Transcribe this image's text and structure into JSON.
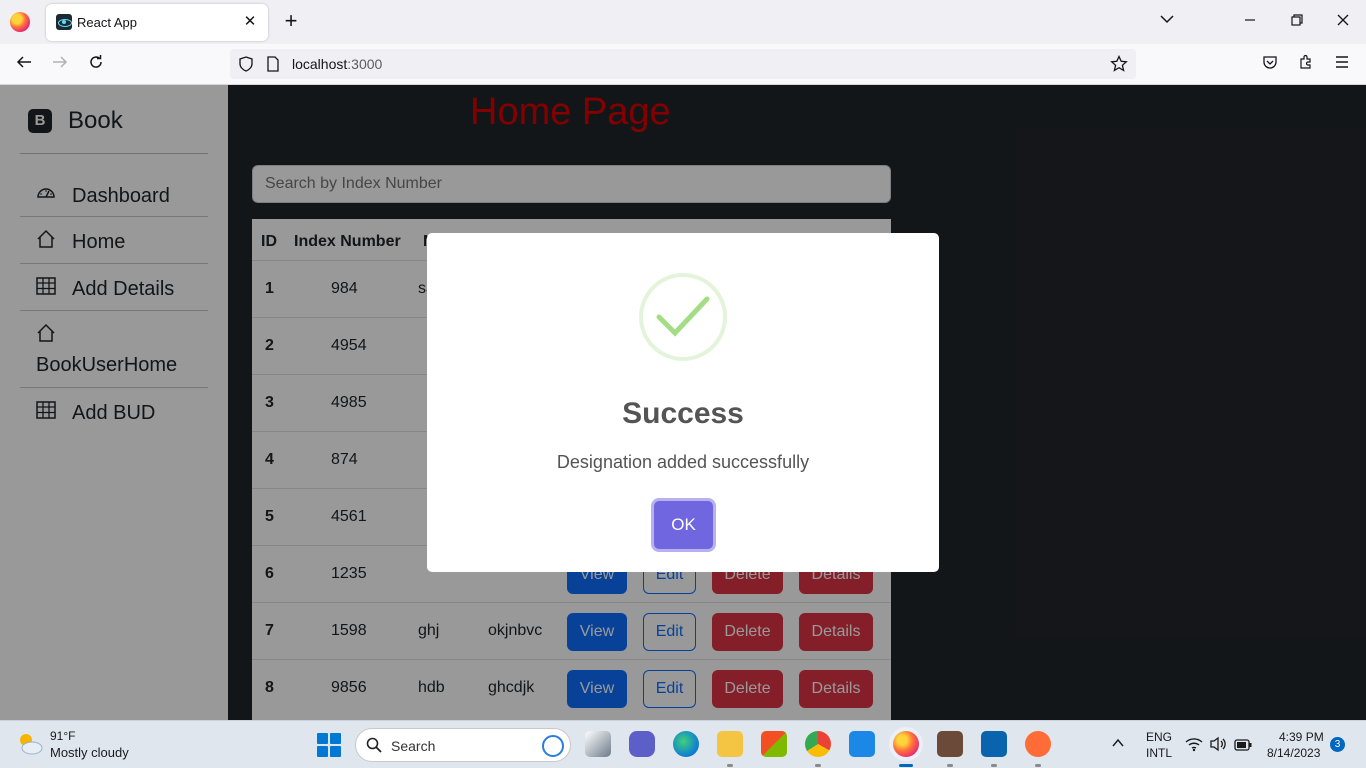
{
  "browser": {
    "tab_title": "React App",
    "url_host": "localhost",
    "url_port": ":3000"
  },
  "sidebar": {
    "brand_letter": "B",
    "brand": "Book",
    "items": [
      {
        "label": "Dashboard",
        "icon": "speedometer-icon"
      },
      {
        "label": "Home",
        "icon": "house-icon"
      },
      {
        "label": "Add Details",
        "icon": "table-icon"
      },
      {
        "label": "BookUserHome",
        "icon": "house-icon"
      },
      {
        "label": "Add BUD",
        "icon": "table-icon"
      }
    ]
  },
  "main": {
    "title": "Home Page",
    "search_placeholder": "Search by Index Number"
  },
  "table": {
    "headers": {
      "id": "ID",
      "index": "Index Number",
      "third_partial": "N"
    },
    "buttons": {
      "view": "View",
      "edit": "Edit",
      "delete": "Delete",
      "details": "Details"
    },
    "rows": [
      {
        "id": "1",
        "index": "984",
        "c3": "sa",
        "c4": "",
        "show_buttons": false
      },
      {
        "id": "2",
        "index": "4954",
        "c3": "",
        "c4": "",
        "show_buttons": false
      },
      {
        "id": "3",
        "index": "4985",
        "c3": "",
        "c4": "",
        "show_buttons": false
      },
      {
        "id": "4",
        "index": "874",
        "c3": "",
        "c4": "",
        "show_buttons": false
      },
      {
        "id": "5",
        "index": "4561",
        "c3": "",
        "c4": "",
        "show_buttons": false
      },
      {
        "id": "6",
        "index": "1235",
        "c3": "",
        "c4": "",
        "show_buttons": true
      },
      {
        "id": "7",
        "index": "1598",
        "c3": "ghj",
        "c4": "okjnbvc",
        "show_buttons": true
      },
      {
        "id": "8",
        "index": "9856",
        "c3": "hdb",
        "c4": "ghcdjk",
        "show_buttons": true
      }
    ]
  },
  "modal": {
    "title": "Success",
    "message": "Designation added successfully",
    "ok_label": "OK"
  },
  "taskbar": {
    "weather_temp": "91°F",
    "weather_desc": "Mostly cloudy",
    "search_label": "Search",
    "lang1": "ENG",
    "lang2": "INTL",
    "time": "4:39 PM",
    "date": "8/14/2023",
    "notifications": "3"
  },
  "colors": {
    "accent": "#0d6efd",
    "danger": "#dc3545",
    "title_red": "#dc0000",
    "swal_confirm": "#7066e0",
    "success_green": "#a5dc86"
  }
}
